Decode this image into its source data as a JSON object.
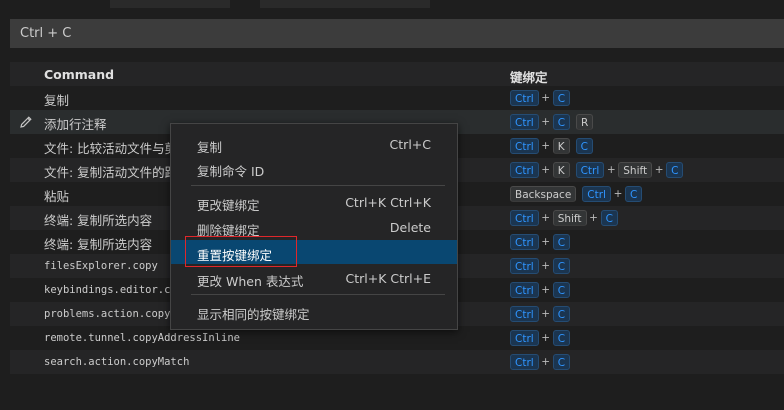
{
  "search": {
    "value": "Ctrl + C"
  },
  "table": {
    "headers": {
      "command": "Command",
      "keybinding": "键绑定"
    },
    "rows": [
      {
        "command": "复制",
        "mono": false,
        "keys": [
          [
            "Ctrl",
            "C"
          ]
        ]
      },
      {
        "command": "添加行注释",
        "mono": false,
        "keys": [
          [
            "Ctrl",
            "C"
          ],
          [
            "R"
          ]
        ]
      },
      {
        "command": "文件: 比较活动文件与剪",
        "mono": false,
        "keys": [
          [
            "Ctrl",
            "K"
          ],
          [
            "C"
          ]
        ]
      },
      {
        "command": "文件: 复制活动文件的路",
        "mono": false,
        "keys": [
          [
            "Ctrl",
            "K"
          ],
          [
            "Ctrl",
            "Shift",
            "C"
          ]
        ]
      },
      {
        "command": "粘贴",
        "mono": false,
        "keys": [
          [
            "Backspace"
          ],
          [
            "Ctrl",
            "C"
          ]
        ]
      },
      {
        "command": "终端: 复制所选内容",
        "mono": false,
        "keys": [
          [
            "Ctrl",
            "Shift",
            "C"
          ]
        ]
      },
      {
        "command": "终端: 复制所选内容",
        "mono": false,
        "keys": [
          [
            "Ctrl",
            "C"
          ]
        ]
      },
      {
        "command": "filesExplorer.copy",
        "mono": true,
        "keys": [
          [
            "Ctrl",
            "C"
          ]
        ]
      },
      {
        "command": "keybindings.editor.c",
        "mono": true,
        "keys": [
          [
            "Ctrl",
            "C"
          ]
        ]
      },
      {
        "command": "problems.action.copy",
        "mono": true,
        "keys": [
          [
            "Ctrl",
            "C"
          ]
        ]
      },
      {
        "command": "remote.tunnel.copyAddressInline",
        "mono": true,
        "keys": [
          [
            "Ctrl",
            "C"
          ]
        ]
      },
      {
        "command": "search.action.copyMatch",
        "mono": true,
        "keys": [
          [
            "Ctrl",
            "C"
          ]
        ]
      }
    ]
  },
  "context_menu": {
    "items": [
      {
        "label": "复制",
        "shortcut": "Ctrl+C"
      },
      {
        "label": "复制命令 ID",
        "shortcut": ""
      },
      {
        "label": "更改键绑定",
        "shortcut": "Ctrl+K Ctrl+K"
      },
      {
        "label": "删除键绑定",
        "shortcut": "Delete"
      },
      {
        "label": "重置按键绑定",
        "shortcut": ""
      },
      {
        "label": "更改 When 表达式",
        "shortcut": "Ctrl+K Ctrl+E"
      },
      {
        "label": "显示相同的按键绑定",
        "shortcut": ""
      }
    ],
    "active_index": 4
  },
  "icons": {
    "edit": "pencil-icon"
  },
  "colors": {
    "accent": "#2f95ff",
    "selection": "#094771",
    "highlight_box": "#e0272b"
  }
}
